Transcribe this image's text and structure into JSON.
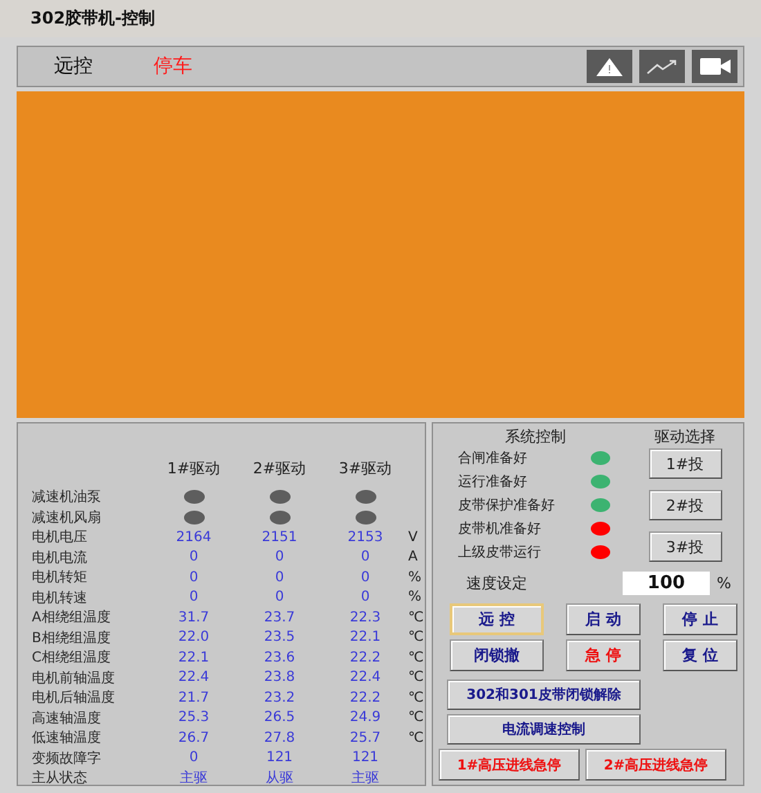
{
  "window": {
    "title": "302胶带机-控制"
  },
  "header": {
    "mode": "远控",
    "status": "停车"
  },
  "drive_table": {
    "columns": [
      "1#驱动",
      "2#驱动",
      "3#驱动"
    ],
    "rows": [
      {
        "kind": "lamp",
        "label": "减速机油泵",
        "lamps": [
          {
            "on": false
          },
          {
            "on": false
          },
          {
            "on": false
          }
        ]
      },
      {
        "kind": "lamp",
        "label": "减速机风扇",
        "lamps": [
          {
            "on": false
          },
          {
            "on": false
          },
          {
            "on": false
          }
        ]
      },
      {
        "kind": "value",
        "label": "电机电压",
        "values": [
          "2164",
          "2151",
          "2153"
        ],
        "unit": "V"
      },
      {
        "kind": "value",
        "label": "电机电流",
        "values": [
          "0",
          "0",
          "0"
        ],
        "unit": "A"
      },
      {
        "kind": "value",
        "label": "电机转矩",
        "values": [
          "0",
          "0",
          "0"
        ],
        "unit": "%"
      },
      {
        "kind": "value",
        "label": "电机转速",
        "values": [
          "0",
          "0",
          "0"
        ],
        "unit": "%"
      },
      {
        "kind": "value",
        "label": "A相绕组温度",
        "values": [
          "31.7",
          "23.7",
          "22.3"
        ],
        "unit": "℃"
      },
      {
        "kind": "value",
        "label": "B相绕组温度",
        "values": [
          "22.0",
          "23.5",
          "22.1"
        ],
        "unit": "℃"
      },
      {
        "kind": "value",
        "label": "C相绕组温度",
        "values": [
          "22.1",
          "23.6",
          "22.2"
        ],
        "unit": "℃"
      },
      {
        "kind": "value",
        "label": "电机前轴温度",
        "values": [
          "22.4",
          "23.8",
          "22.4"
        ],
        "unit": "℃"
      },
      {
        "kind": "value",
        "label": "电机后轴温度",
        "values": [
          "21.7",
          "23.2",
          "22.2"
        ],
        "unit": "℃"
      },
      {
        "kind": "value",
        "label": "高速轴温度",
        "values": [
          "25.3",
          "26.5",
          "24.9"
        ],
        "unit": "℃"
      },
      {
        "kind": "value",
        "label": "低速轴温度",
        "values": [
          "26.7",
          "27.8",
          "25.7"
        ],
        "unit": "℃"
      },
      {
        "kind": "value",
        "label": "变频故障字",
        "values": [
          "0",
          "121",
          "121"
        ]
      },
      {
        "kind": "value",
        "label": "主从状态",
        "values": [
          "主驱",
          "从驱",
          "主驱"
        ]
      }
    ]
  },
  "system_control": {
    "title": "系统控制",
    "items": [
      {
        "label": "合闸准备好",
        "color": "#3cb371"
      },
      {
        "label": "运行准备好",
        "color": "#3cb371"
      },
      {
        "label": "皮带保护准备好",
        "color": "#3cb371"
      },
      {
        "label": "皮带机准备好",
        "color": "#ff0000"
      },
      {
        "label": "上级皮带运行",
        "color": "#ff0000"
      }
    ]
  },
  "drive_select": {
    "title": "驱动选择",
    "buttons": [
      "1#投",
      "2#投",
      "3#投"
    ]
  },
  "speed": {
    "label": "速度设定",
    "value": "100",
    "unit": "%"
  },
  "control_buttons": [
    {
      "label": "远 控",
      "kind": "normal",
      "selected": true
    },
    {
      "label": "启 动",
      "kind": "normal",
      "selected": false
    },
    {
      "label": "停 止",
      "kind": "normal",
      "selected": false
    },
    {
      "label": "闭锁撤",
      "kind": "normal",
      "selected": false
    },
    {
      "label": "急 停",
      "kind": "danger",
      "selected": false
    },
    {
      "label": "复 位",
      "kind": "normal",
      "selected": false
    }
  ],
  "wide_buttons": [
    {
      "label": "302和301皮带闭锁解除",
      "kind": "normal"
    },
    {
      "label": "电流调速控制",
      "kind": "normal"
    }
  ],
  "emergency_buttons": [
    {
      "label": "1#高压进线急停",
      "kind": "danger"
    },
    {
      "label": "2#高压进线急停",
      "kind": "danger"
    }
  ]
}
